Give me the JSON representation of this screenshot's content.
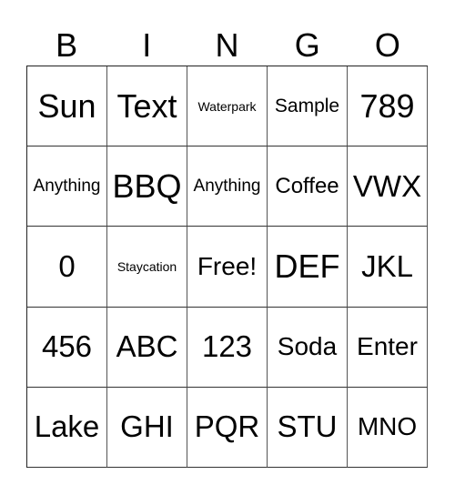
{
  "header": [
    "B",
    "I",
    "N",
    "G",
    "O"
  ],
  "rows": [
    [
      "Sun",
      "Text",
      "Waterpark",
      "Sample",
      "789"
    ],
    [
      "Anything",
      "BBQ",
      "Anything",
      "Coffee",
      "VWX"
    ],
    [
      "0",
      "Staycation",
      "Free!",
      "DEF",
      "JKL"
    ],
    [
      "456",
      "ABC",
      "123",
      "Soda",
      "Enter"
    ],
    [
      "Lake",
      "GHI",
      "PQR",
      "STU",
      "MNO"
    ]
  ]
}
